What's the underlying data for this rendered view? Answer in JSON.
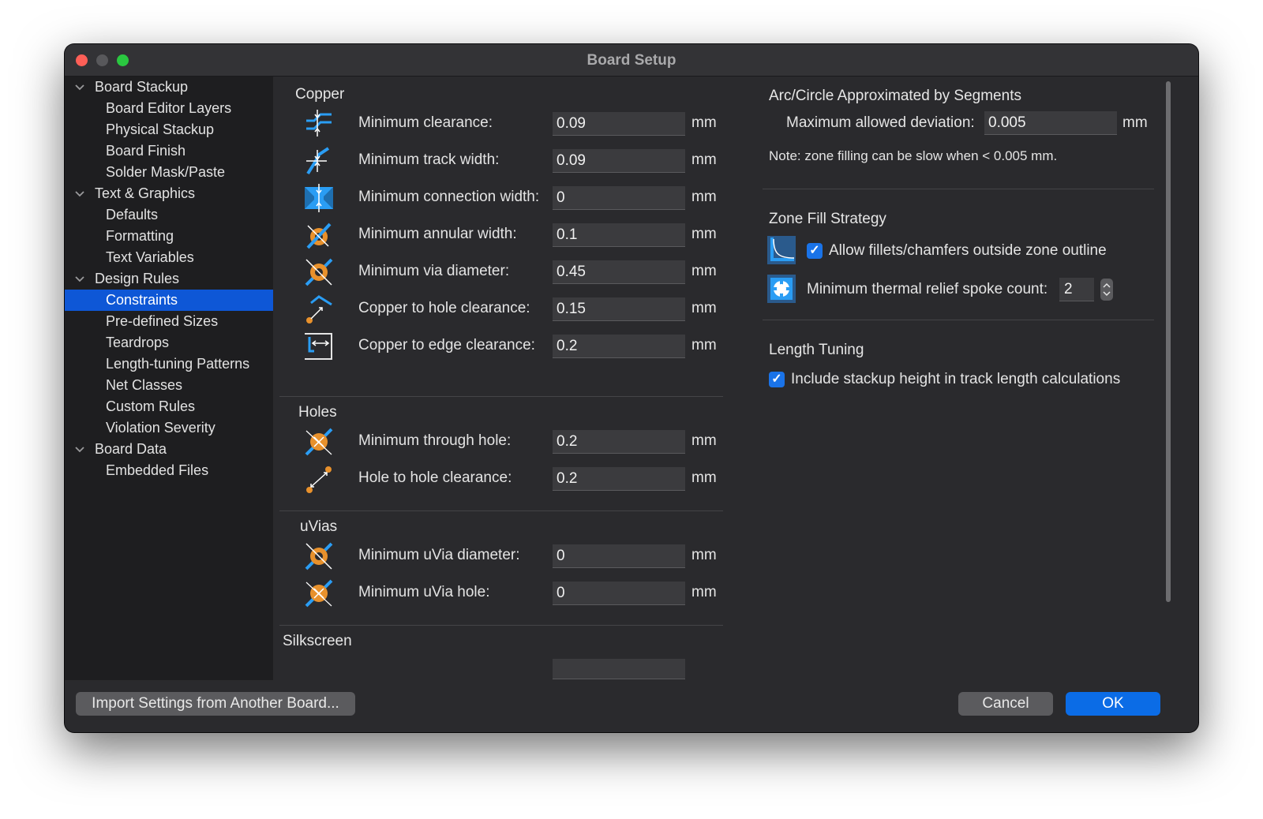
{
  "window": {
    "title": "Board Setup"
  },
  "sidebar": {
    "items": [
      {
        "label": "Board Stackup",
        "level": 0
      },
      {
        "label": "Board Editor Layers",
        "level": 1
      },
      {
        "label": "Physical Stackup",
        "level": 1
      },
      {
        "label": "Board Finish",
        "level": 1
      },
      {
        "label": "Solder Mask/Paste",
        "level": 1
      },
      {
        "label": "Text & Graphics",
        "level": 0
      },
      {
        "label": "Defaults",
        "level": 1
      },
      {
        "label": "Formatting",
        "level": 1
      },
      {
        "label": "Text Variables",
        "level": 1
      },
      {
        "label": "Design Rules",
        "level": 0
      },
      {
        "label": "Constraints",
        "level": 1,
        "selected": true
      },
      {
        "label": "Pre-defined Sizes",
        "level": 1
      },
      {
        "label": "Teardrops",
        "level": 1
      },
      {
        "label": "Length-tuning Patterns",
        "level": 1
      },
      {
        "label": "Net Classes",
        "level": 1
      },
      {
        "label": "Custom Rules",
        "level": 1
      },
      {
        "label": "Violation Severity",
        "level": 1
      },
      {
        "label": "Board Data",
        "level": 0
      },
      {
        "label": "Embedded Files",
        "level": 1
      }
    ]
  },
  "copper": {
    "title": "Copper",
    "unit": "mm",
    "rows": [
      {
        "label": "Minimum clearance:",
        "value": "0.09",
        "icon": "clearance-icon"
      },
      {
        "label": "Minimum track width:",
        "value": "0.09",
        "icon": "track-width-icon"
      },
      {
        "label": "Minimum connection width:",
        "value": "0",
        "icon": "connection-width-icon"
      },
      {
        "label": "Minimum annular width:",
        "value": "0.1",
        "icon": "annular-width-icon"
      },
      {
        "label": "Minimum via diameter:",
        "value": "0.45",
        "icon": "via-diameter-icon"
      },
      {
        "label": "Copper to hole clearance:",
        "value": "0.15",
        "icon": "copper-hole-clearance-icon"
      },
      {
        "label": "Copper to edge clearance:",
        "value": "0.2",
        "icon": "copper-edge-clearance-icon"
      }
    ]
  },
  "holes": {
    "title": "Holes",
    "unit": "mm",
    "rows": [
      {
        "label": "Minimum through hole:",
        "value": "0.2",
        "icon": "through-hole-icon"
      },
      {
        "label": "Hole to hole clearance:",
        "value": "0.2",
        "icon": "hole-to-hole-icon"
      }
    ]
  },
  "uvias": {
    "title": "uVias",
    "unit": "mm",
    "rows": [
      {
        "label": "Minimum uVia diameter:",
        "value": "0",
        "icon": "uvia-diameter-icon"
      },
      {
        "label": "Minimum uVia hole:",
        "value": "0",
        "icon": "uvia-hole-icon"
      }
    ]
  },
  "silkscreen": {
    "title": "Silkscreen"
  },
  "arc": {
    "title": "Arc/Circle Approximated by Segments",
    "deviation_label": "Maximum allowed deviation:",
    "deviation_value": "0.005",
    "unit": "mm",
    "note": "Note: zone filling can be slow when < 0.005 mm."
  },
  "zone_fill": {
    "title": "Zone Fill Strategy",
    "fillets_label": "Allow fillets/chamfers outside zone outline",
    "fillets_checked": true,
    "spoke_label": "Minimum thermal relief spoke count:",
    "spoke_value": "2"
  },
  "length_tuning": {
    "title": "Length Tuning",
    "stackup_label": "Include stackup height in track length calculations",
    "stackup_checked": true
  },
  "footer": {
    "import_label": "Import Settings from Another Board...",
    "cancel_label": "Cancel",
    "ok_label": "OK"
  },
  "colors": {
    "accent": "#0b6ce6",
    "selection": "#0e57d6",
    "icon_blue": "#2a9df4",
    "icon_orange": "#e8912c"
  }
}
